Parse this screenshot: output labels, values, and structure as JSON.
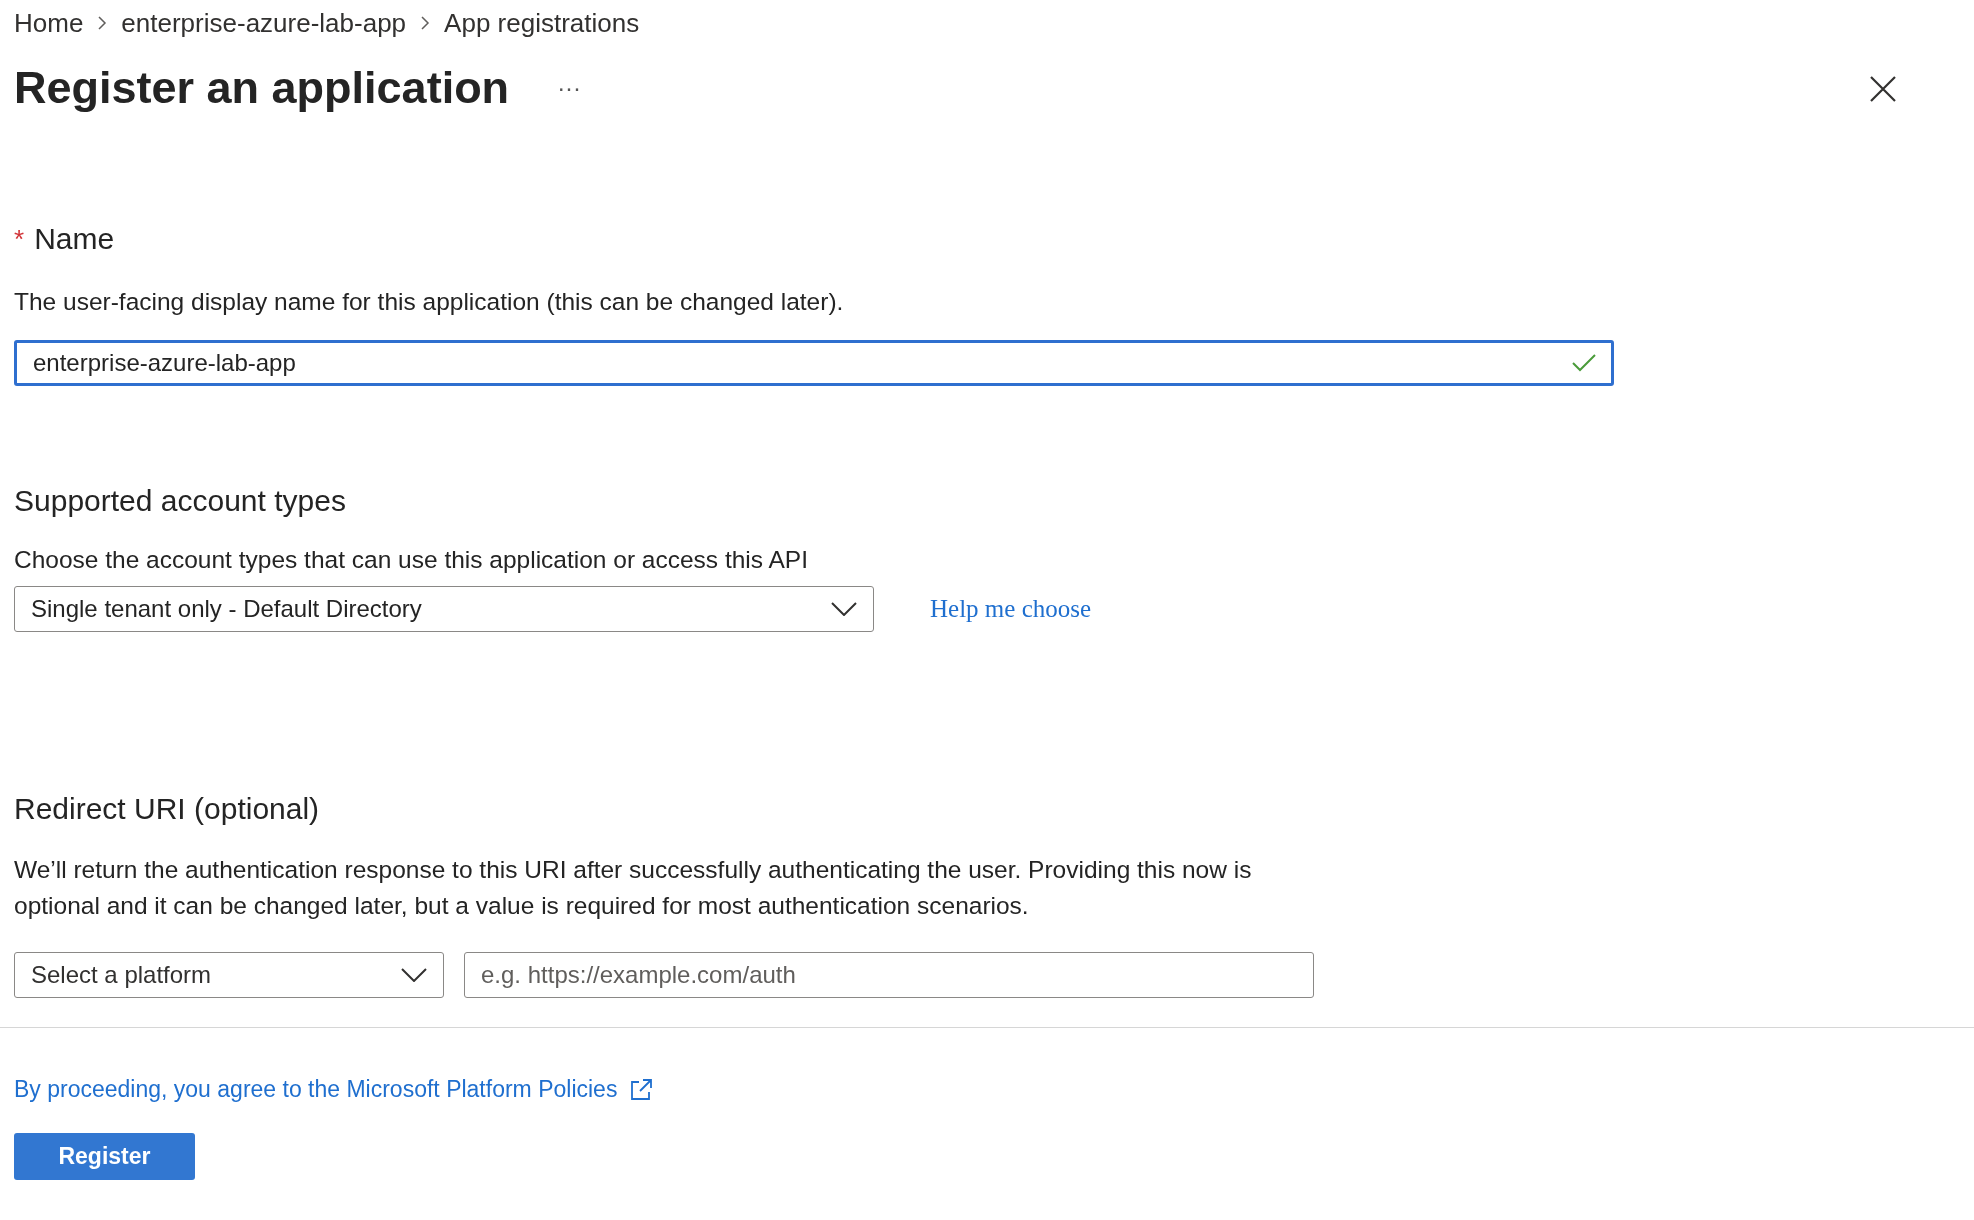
{
  "breadcrumb": [
    {
      "label": "Home"
    },
    {
      "label": "enterprise-azure-lab-app"
    },
    {
      "label": "App registrations"
    }
  ],
  "title": "Register an application",
  "more": "···",
  "name_section": {
    "required_mark": "*",
    "label": "Name",
    "description": "The user-facing display name for this application (this can be changed later).",
    "value": "enterprise-azure-lab-app",
    "valid": true
  },
  "account_section": {
    "label": "Supported account types",
    "description": "Choose the account types that can use this application or access this API",
    "selected": "Single tenant only - Default Directory",
    "help_link": "Help me choose"
  },
  "redirect_section": {
    "label": "Redirect URI (optional)",
    "description": "We’ll return the authentication response to this URI after successfully authenticating the user. Providing this now is optional and it can be changed later, but a value is required for most authentication scenarios.",
    "platform_placeholder": "Select a platform",
    "uri_placeholder": "e.g. https://example.com/auth"
  },
  "policy_link": "By proceeding, you agree to the Microsoft Platform Policies",
  "register_button": "Register"
}
